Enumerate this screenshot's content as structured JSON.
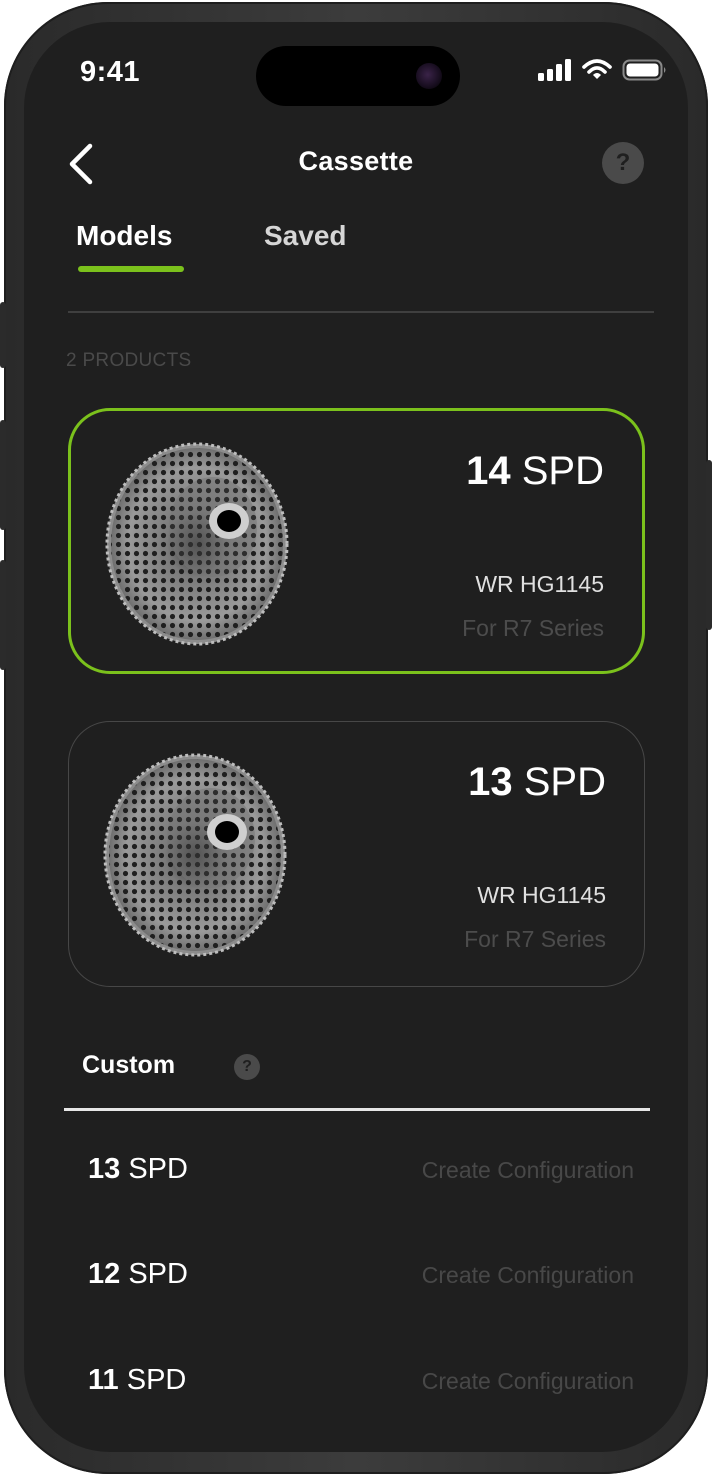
{
  "status_bar": {
    "time": "9:41"
  },
  "header": {
    "title": "Cassette",
    "help_label": "?"
  },
  "tabs": [
    {
      "label": "Models",
      "active": true
    },
    {
      "label": "Saved",
      "active": false
    }
  ],
  "products": {
    "count_label": "2 PRODUCTS",
    "items": [
      {
        "speed_number": "14",
        "speed_unit": "SPD",
        "model": "WR HG1145",
        "series": "For R7 Series",
        "selected": true
      },
      {
        "speed_number": "13",
        "speed_unit": "SPD",
        "model": "WR HG1145",
        "series": "For R7 Series",
        "selected": false
      }
    ]
  },
  "custom": {
    "heading": "Custom",
    "help_label": "?",
    "rows": [
      {
        "speed_number": "13",
        "speed_unit": "SPD",
        "action": "Create Configuration"
      },
      {
        "speed_number": "12",
        "speed_unit": "SPD",
        "action": "Create Configuration"
      },
      {
        "speed_number": "11",
        "speed_unit": "SPD",
        "action": "Create Configuration"
      }
    ]
  },
  "colors": {
    "accent": "#7bc11c",
    "background": "#1f1f1f",
    "frame": "#2f2f2f",
    "muted_text": "#4c4c4c"
  },
  "icons": {
    "back": "chevron-left-icon",
    "help": "question-mark-icon",
    "signal": "cellular-signal-icon",
    "wifi": "wifi-icon",
    "battery": "battery-icon"
  }
}
